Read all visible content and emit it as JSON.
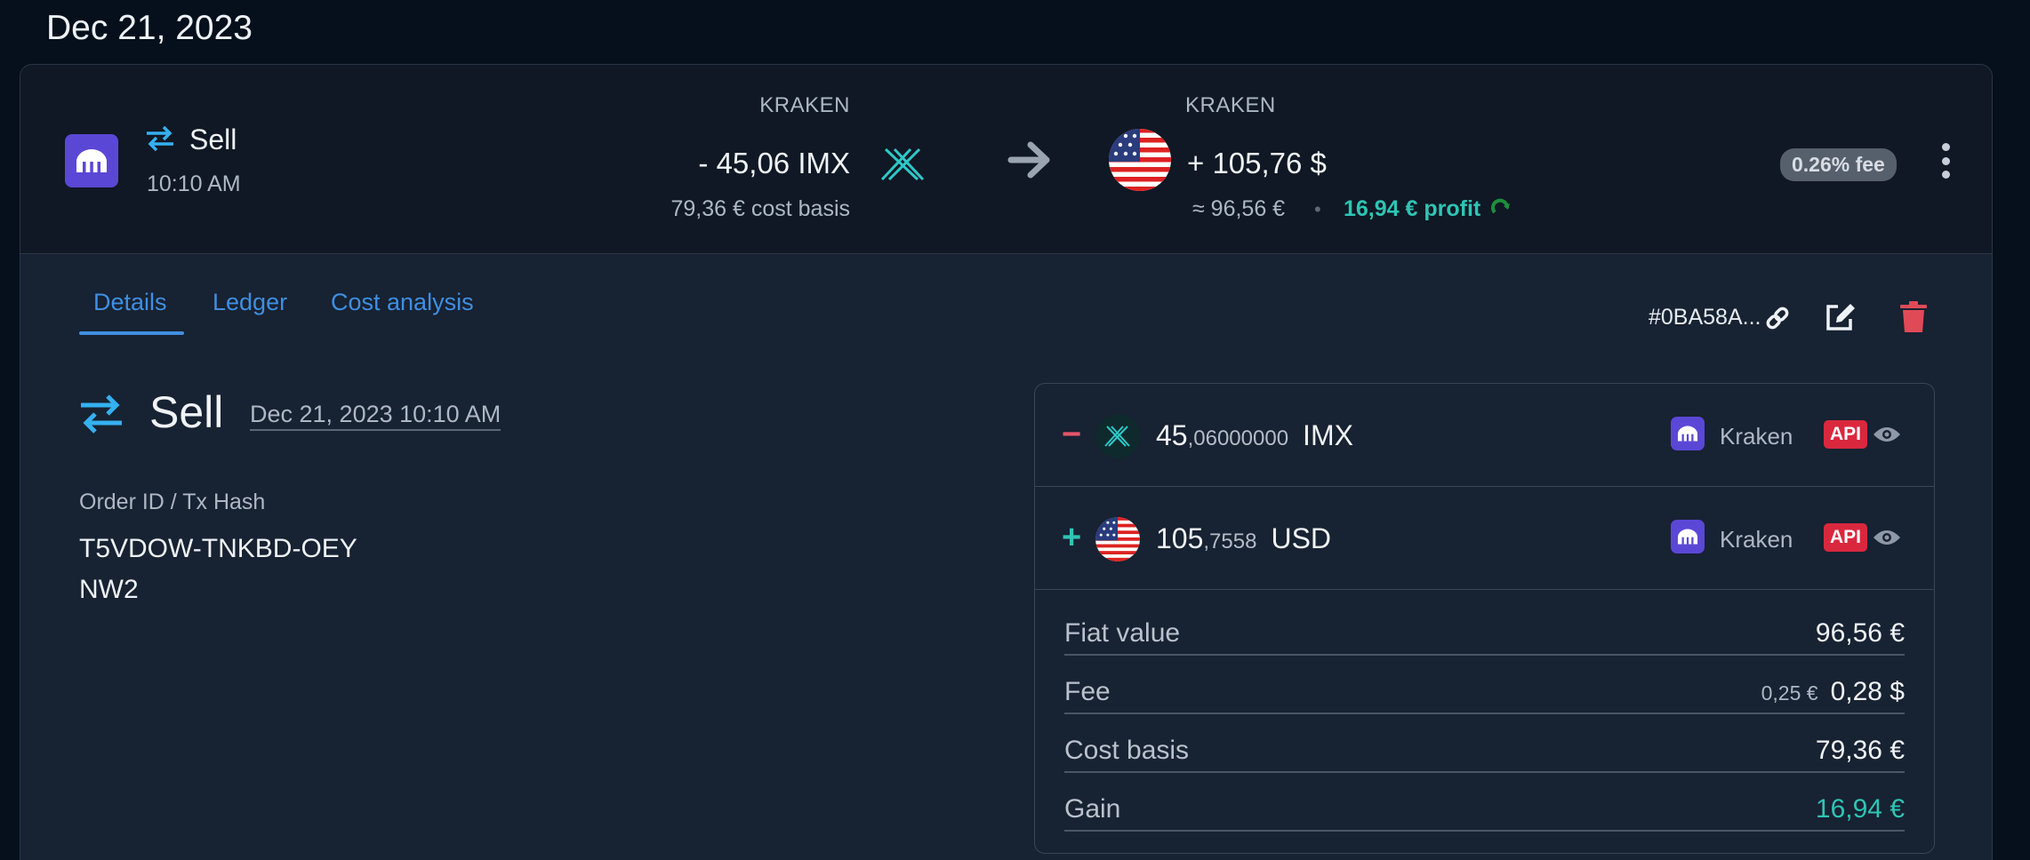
{
  "date_heading": "Dec 21, 2023",
  "summary": {
    "type": "Sell",
    "time": "10:10 AM",
    "from_exchange": "KRAKEN",
    "to_exchange": "KRAKEN",
    "amount_out": "- 45,06 IMX",
    "cost_basis": "79,36 € cost basis",
    "amount_in": "+ 105,76 $",
    "approx_value": "≈ 96,56 €",
    "separator": "•",
    "profit": "16,94 € profit",
    "fee_badge": "0.26% fee"
  },
  "tabs": [
    {
      "label": "Details",
      "active": true
    },
    {
      "label": "Ledger",
      "active": false
    },
    {
      "label": "Cost analysis",
      "active": false
    }
  ],
  "tx_hash_short": "#0BA58A...",
  "details": {
    "type": "Sell",
    "datetime": "Dec 21, 2023 10:10 AM",
    "order_label": "Order ID / Tx Hash",
    "order_value": "T5VDOW-TNKBD-OEYNW2"
  },
  "legs": [
    {
      "sign": "−",
      "amount_int": "45",
      "amount_dec": ",06000000",
      "asset": "IMX",
      "exchange": "Kraken",
      "badge": "API"
    },
    {
      "sign": "+",
      "amount_int": "105",
      "amount_dec": ",7558",
      "asset": "USD",
      "exchange": "Kraken",
      "badge": "API"
    }
  ],
  "values": {
    "fiat_label": "Fiat value",
    "fiat_value": "96,56 €",
    "fee_label": "Fee",
    "fee_sub": "0,25 €",
    "fee_value": "0,28 $",
    "cost_label": "Cost basis",
    "cost_value": "79,36 €",
    "gain_label": "Gain",
    "gain_value": "16,94 €"
  },
  "colors": {
    "accent": "#3f8fe2",
    "positive": "#2fc4b4",
    "negative": "#e8546c",
    "kraken": "#5b47d6",
    "api_badge": "#d9283e",
    "delete": "#e04a57"
  },
  "icons": [
    "kraken-logo-icon",
    "swap-icon",
    "imx-icon",
    "arrow-right-icon",
    "us-flag-icon",
    "refresh-icon",
    "kebab-menu-icon",
    "link-icon",
    "edit-icon",
    "trash-icon",
    "eye-icon"
  ]
}
